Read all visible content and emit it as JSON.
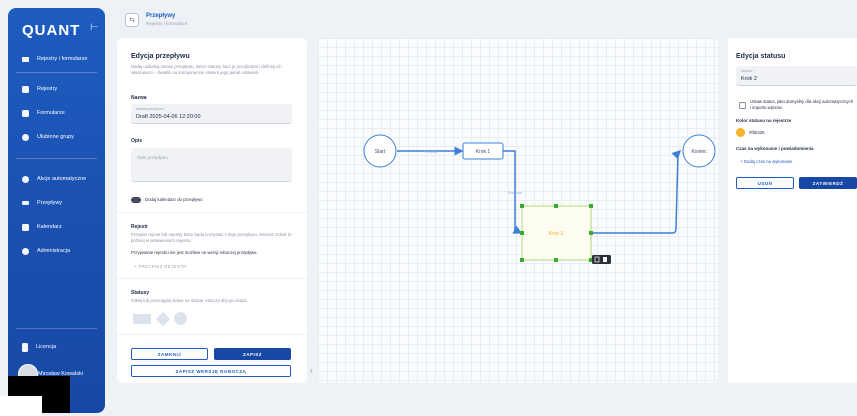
{
  "sidebar": {
    "logo": "QUANT",
    "collapse_icon": "⊢",
    "items": [
      {
        "label": "Rejestry i formularze",
        "icon": "hamburger-icon"
      },
      {
        "label": "Rejestry",
        "icon": "grid-icon"
      },
      {
        "label": "Formularze",
        "icon": "document-icon"
      },
      {
        "label": "Ulubione grupy",
        "icon": "thumb-icon"
      },
      {
        "label": "Akcje automatyczne",
        "icon": "robot-icon"
      },
      {
        "label": "Przepływy",
        "icon": "flow-icon"
      },
      {
        "label": "Kalendarz",
        "icon": "calendar-icon"
      },
      {
        "label": "Administracja",
        "icon": "gear-icon"
      }
    ],
    "license": "Licencja",
    "user": "Mirosław Kowalski"
  },
  "header": {
    "icon": "⇆",
    "title": "Przepływy",
    "subtitle": "Rejestry i formularze"
  },
  "form": {
    "title": "Edycja przepływu",
    "description": "Nadaj unikalną nazwę przepływu, twórz statusy, łącz je przejściami i definiuj ich właściwości - dwuklik na komponencie otwiera jego panel ustawień.",
    "name_label": "Nazwa",
    "name_field_label": "Nazwa przepływu *",
    "name_value": "Draft 2025-04-06 12:20:00",
    "desc_label": "Opis",
    "desc_placeholder": "Opis przepływu",
    "calendar_toggle": "Dodaj kalendarz do przepływu",
    "registry_label": "Rejestr",
    "registry_text": "Przypisz rejestr lub rejestry które będą korzystać z tego przepływu. Możesz zrobić to później w ustawieniach rejestru.",
    "registry_warning": "Przypisanie rejestru nie jest możliwe ne wersji roboczej przepływu.",
    "assign_registry": "+ PRZYPISZ REJESTR",
    "statuses_label": "Statusy",
    "statuses_text": "Kliknij lub przeciągnij status na obszar roboczy aby go dodać.",
    "close_button": "ZAMKNIJ",
    "save_button": "ZAPISZ",
    "save_draft_button": "ZAPISZ WERSJĘ ROBOCZĄ",
    "collapse_arrow": "‹"
  },
  "canvas": {
    "nodes": {
      "start": "Start",
      "step1": "Krok 1",
      "step2": "Krok 2",
      "end": "Koniec"
    },
    "edge_labels": {
      "start_step1": "Przejście",
      "step1_step2": "Przejście"
    },
    "accent": "#3f7fd8",
    "selected": "#62c25a"
  },
  "status_panel": {
    "title": "Edycja statusu",
    "name_field_label": "Nazwa *",
    "name_value": "Krok 2",
    "default_checkbox": "Ustaw status, jako domyślny dla akcji automatycznych i importu wpisów.",
    "color_label": "Kolor statusu na rejestrze",
    "color_value": "#f6b326",
    "time_label": "Czas na wykonanie i powiadomienia",
    "add_time": "+ Dodaj czas na wykonanie",
    "delete_button": "USUŃ",
    "confirm_button": "ZATWIERDŹ"
  }
}
